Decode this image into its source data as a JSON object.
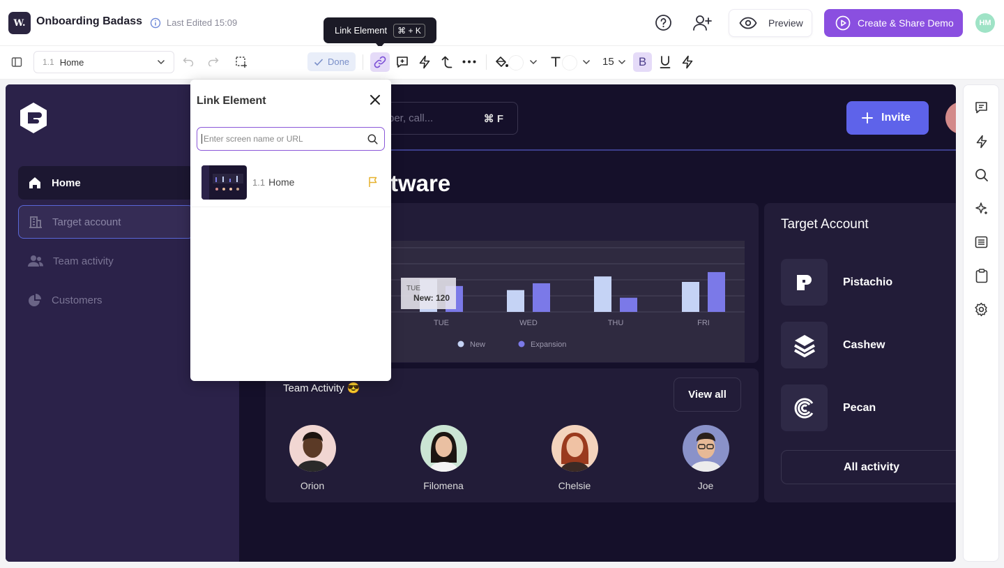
{
  "app": {
    "logo_text": "W.",
    "title": "Onboarding Badass",
    "last_edited": "Last Edited 15:09"
  },
  "header": {
    "preview_label": "Preview",
    "create_label": "Create & Share Demo",
    "avatar_initials": "HM"
  },
  "toolbar": {
    "screen_number": "1.1",
    "screen_name": "Home",
    "done_label": "Done",
    "tooltip_label": "Link Element",
    "tooltip_shortcut": "⌘ + K",
    "font_size": "15",
    "bold_label": "B"
  },
  "popover": {
    "title": "Link Element",
    "search_placeholder": "Enter screen name or URL",
    "items": [
      {
        "number": "1.1",
        "label": "Home"
      }
    ]
  },
  "demo": {
    "nav": [
      {
        "label": "Home",
        "icon": "home-icon"
      },
      {
        "label": "Target account",
        "icon": "building-icon"
      },
      {
        "label": "Team activity",
        "icon": "users-icon"
      },
      {
        "label": "Customers",
        "icon": "pie-chart-icon"
      }
    ],
    "search_text": "ber, call...",
    "search_shortcut": "⌘ F",
    "invite_label": "Invite",
    "heading": "tware",
    "activity_title": "Team Activity 😎",
    "view_all_label": "View all",
    "members": [
      "Orion",
      "Filomena",
      "Chelsie",
      "Joe"
    ],
    "target_title": "Target Account",
    "accounts": [
      "Pistachio",
      "Cashew",
      "Pecan"
    ],
    "all_activity_label": "All activity"
  },
  "chart_data": {
    "type": "bar",
    "categories": [
      "TUE",
      "WED",
      "THU",
      "FRI"
    ],
    "series": [
      {
        "name": "New",
        "values": [
          120,
          80,
          130,
          110
        ],
        "color": "#c5d3f5"
      },
      {
        "name": "Expansion",
        "values": [
          95,
          105,
          52,
          146
        ],
        "color": "#7b79e8"
      }
    ],
    "ylim": [
      0,
      220
    ],
    "legend": "bottom",
    "grid": true,
    "tooltip": {
      "category": "TUE",
      "text": "New: 120"
    }
  },
  "colors": {
    "accent": "#8a4fe0",
    "invite": "#5e63ea",
    "frame_bg": "#15102a",
    "sidebar_bg": "#2b2249"
  }
}
